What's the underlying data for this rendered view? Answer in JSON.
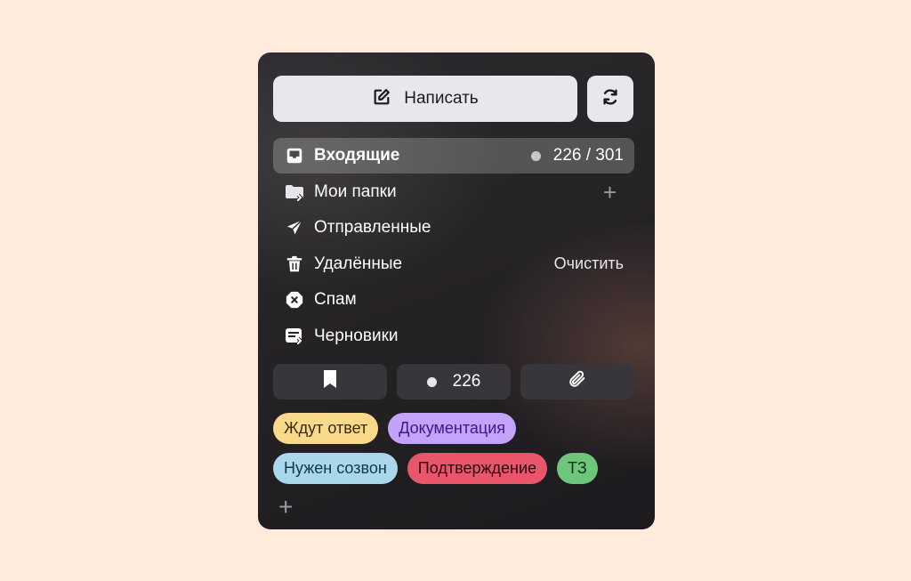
{
  "compose": {
    "label": "Написать",
    "icon": "edit-icon"
  },
  "refresh": {
    "icon": "refresh-icon"
  },
  "folders": [
    {
      "label": "Входящие",
      "icon": "inbox-icon",
      "unread": "226",
      "total": "301",
      "count_text": "226 / 301",
      "active": true
    },
    {
      "label": "Мои папки",
      "icon": "folder-icon",
      "action": "+"
    },
    {
      "label": "Отправленные",
      "icon": "send-icon"
    },
    {
      "label": "Удалённые",
      "icon": "trash-icon",
      "action": "Очистить"
    },
    {
      "label": "Спам",
      "icon": "spam-icon"
    },
    {
      "label": "Черновики",
      "icon": "drafts-icon"
    }
  ],
  "filters": {
    "bookmark_icon": "bookmark-icon",
    "unread_count": "226",
    "attachment_icon": "paperclip-icon"
  },
  "labels": [
    [
      {
        "text": "Ждут ответ",
        "bg": "#fbd98a",
        "fg": "#3a2a0a"
      },
      {
        "text": "Документация",
        "bg": "#c3a3fb",
        "fg": "#3d1a86"
      }
    ],
    [
      {
        "text": "Нужен созвон",
        "bg": "#a9d8ec",
        "fg": "#123748"
      },
      {
        "text": "Подтверждение",
        "bg": "#e9566c",
        "fg": "#2d0a0f"
      },
      {
        "text": "ТЗ",
        "bg": "#6ec67b",
        "fg": "#0f3215"
      }
    ]
  ],
  "add_label": "+",
  "colors": {
    "page_bg": "#ffebdc",
    "panel_bg": "#262326",
    "button_bg": "#e9e7ee",
    "active_row": "#5a5859"
  }
}
